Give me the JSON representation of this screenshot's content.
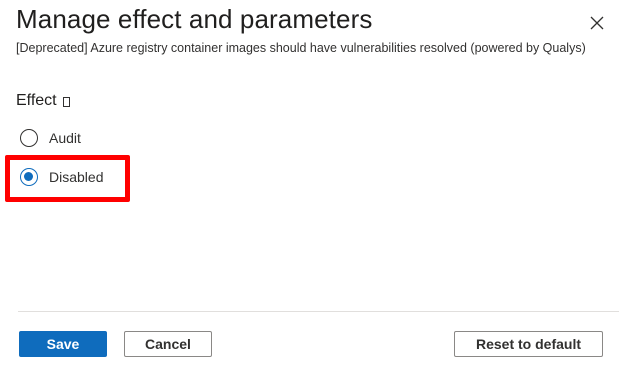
{
  "header": {
    "title": "Manage effect and parameters",
    "subtitle": "[Deprecated] Azure registry container images should have vulnerabilities resolved (powered by Qualys)",
    "close_icon": "close-icon"
  },
  "effect": {
    "heading": "Effect",
    "info_icon": "info-icon",
    "options": [
      {
        "label": "Audit",
        "selected": false
      },
      {
        "label": "Disabled",
        "selected": true
      }
    ],
    "highlight_color": "#ff0000"
  },
  "footer": {
    "save_label": "Save",
    "cancel_label": "Cancel",
    "reset_label": "Reset to default"
  },
  "colors": {
    "accent": "#0f6cbd",
    "highlight": "#ff0000"
  }
}
